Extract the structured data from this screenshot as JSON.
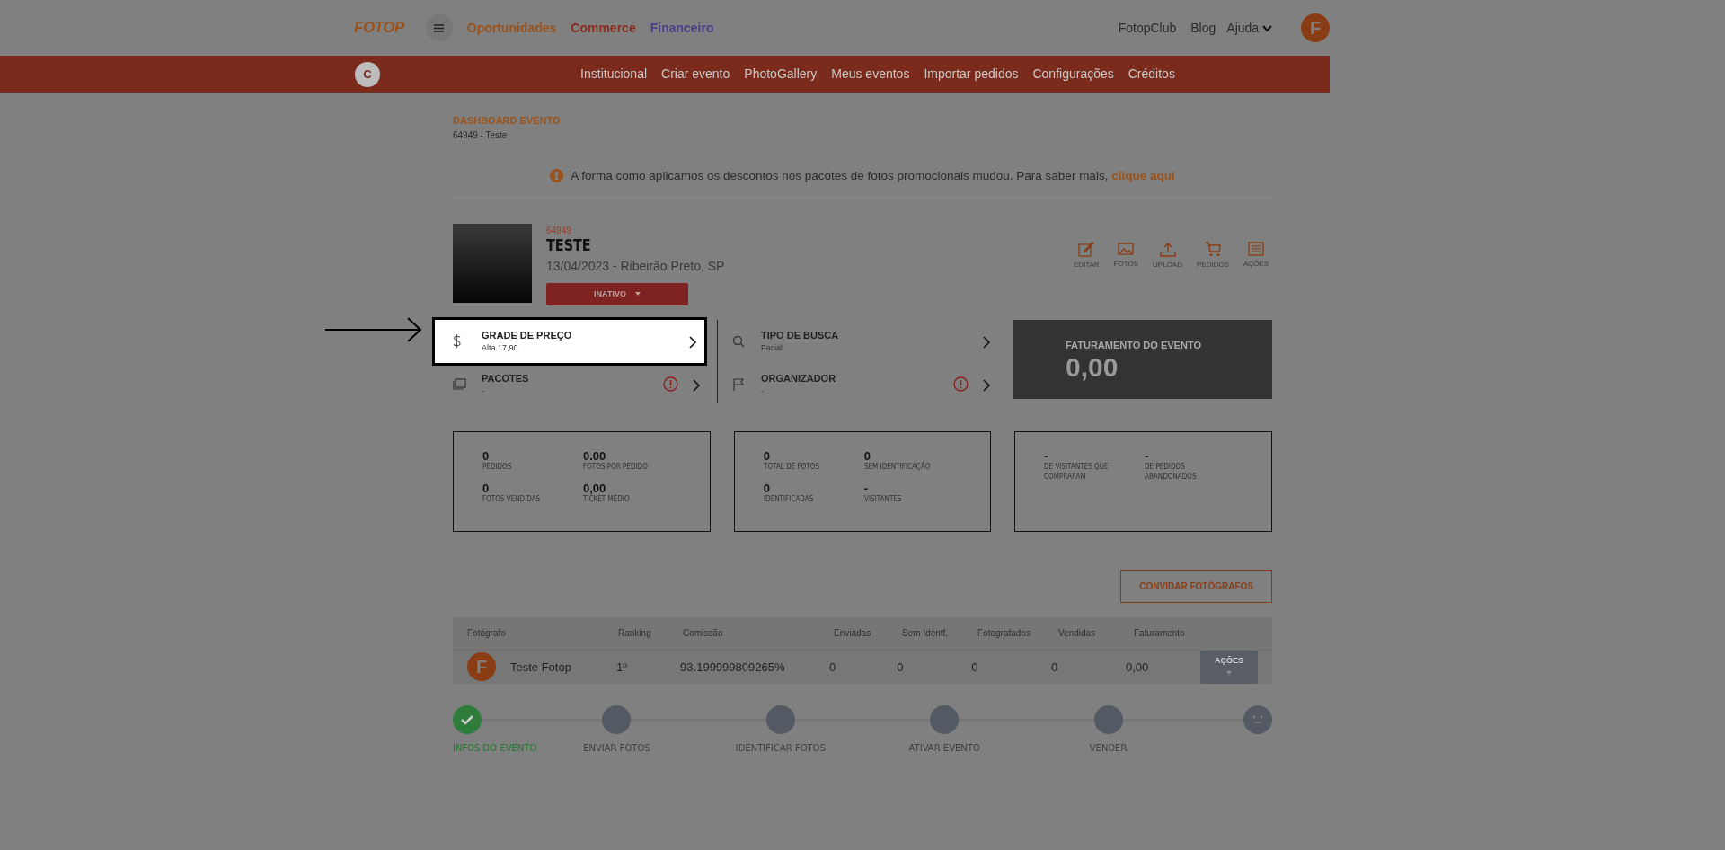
{
  "topbar": {
    "logo": "FOTOP",
    "links": [
      {
        "label": "Oportunidades",
        "color": "#9a531c"
      },
      {
        "label": "Commerce",
        "color": "#8c2c1c"
      },
      {
        "label": "Financeiro",
        "color": "#4a3f86"
      }
    ],
    "right_links": [
      "FotopClub",
      "Blog"
    ],
    "help": "Ajuda",
    "avatar": "F"
  },
  "subnav": {
    "avatar": "C",
    "items": [
      "Institucional",
      "Criar evento",
      "PhotoGallery",
      "Meus eventos",
      "Importar pedidos",
      "Configurações",
      "Créditos"
    ]
  },
  "breadcrumb": {
    "title": "DASHBOARD EVENTO",
    "subtitle": "64949 - Teste"
  },
  "notice": {
    "text": "A forma como aplicamos os descontos nos pacotes de fotos promocionais mudou. Para saber mais,",
    "link": "clique aqui"
  },
  "event": {
    "id": "64949",
    "name": "TESTE",
    "date_place": "13/04/2023 - Ribeirão Preto, SP",
    "status": "INATIVO",
    "actions": [
      {
        "kind": "edit",
        "label": "EDITAR"
      },
      {
        "kind": "photos",
        "label": "FOTOS"
      },
      {
        "kind": "upload",
        "label": "UPLOAD"
      },
      {
        "kind": "cart",
        "label": "PEDIDOS"
      },
      {
        "kind": "list",
        "label": "AÇÕES"
      }
    ]
  },
  "tiles": [
    {
      "kind": "dollar",
      "title": "GRADE DE PREÇO",
      "value": "Alta 17,90",
      "warning": false,
      "highlighted": true
    },
    {
      "kind": "search",
      "title": "TIPO DE BUSCA",
      "value": "Facial",
      "warning": false,
      "highlighted": false
    },
    {
      "kind": "image",
      "title": "PACOTES",
      "value": "-",
      "warning": true,
      "highlighted": false
    },
    {
      "kind": "flag",
      "title": "ORGANIZADOR",
      "value": "-",
      "warning": true,
      "highlighted": false
    }
  ],
  "revenue": {
    "label": "FATURAMENTO DO EVENTO",
    "value": "0,00"
  },
  "stat_cards": [
    [
      {
        "value": "0",
        "label": "PEDIDOS"
      },
      {
        "value": "0.00",
        "label": "FOTOS POR PEDIDO"
      },
      {
        "value": "0",
        "label": "FOTOS VENDIDAS"
      },
      {
        "value": "0,00",
        "label": "TICKET MÉDIO"
      }
    ],
    [
      {
        "value": "0",
        "label": "TOTAL DE FOTOS"
      },
      {
        "value": "0",
        "label": "SEM IDENTIFICAÇÃO"
      },
      {
        "value": "0",
        "label": "IDENTIFICADAS"
      },
      {
        "value": "-",
        "label": "VISITANTES"
      }
    ],
    [
      {
        "value": "-",
        "label": "DE VISITANTES QUE COMPRARAM"
      },
      {
        "value": "-",
        "label": "DE PEDIDOS ABANDONADOS"
      }
    ]
  ],
  "invite_button": "CONVIDAR FOTÓGRAFOS",
  "table": {
    "columns": [
      "Fotógrafo",
      "Ranking",
      "Comissão",
      "Enviadas",
      "Sem Identf.",
      "Fotografados",
      "Vendidas",
      "Faturamento"
    ],
    "rows": [
      {
        "avatar": "F",
        "cells": [
          "Teste Fotop",
          "1º",
          "93.199999809265%",
          "0",
          "0",
          "0",
          "0",
          "0,00"
        ],
        "action": "AÇÕES"
      }
    ]
  },
  "steps": [
    {
      "label": "INFOS DO EVENTO",
      "done": true
    },
    {
      "label": "ENVIAR FOTOS",
      "done": false
    },
    {
      "label": "IDENTIFICAR FOTOS",
      "done": false
    },
    {
      "label": "ATIVAR EVENTO",
      "done": false
    },
    {
      "label": "VENDER",
      "done": false
    },
    {
      "kind": "face"
    }
  ]
}
